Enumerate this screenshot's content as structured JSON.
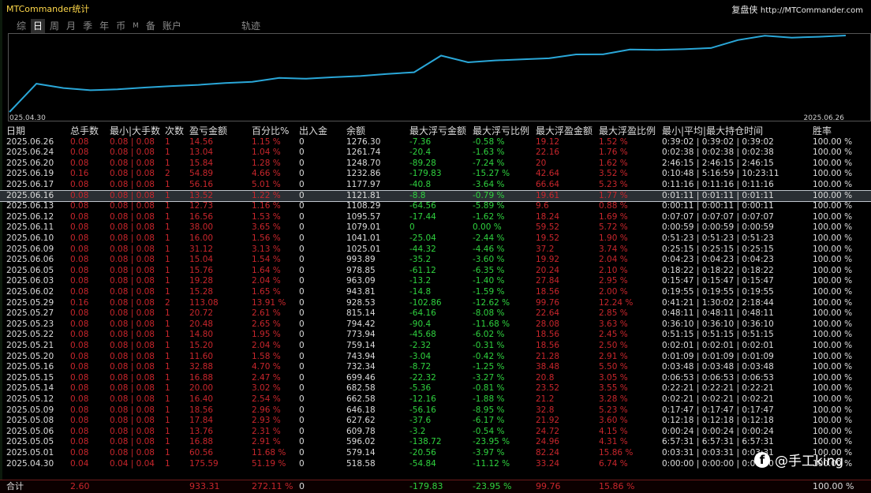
{
  "app": {
    "title": "MTCommander统计",
    "brand_name": "复盘侠",
    "brand_url": "http://MTCommander.com"
  },
  "tabs": [
    {
      "label": "综",
      "active": false
    },
    {
      "label": "日",
      "active": true
    },
    {
      "label": "周",
      "active": false
    },
    {
      "label": "月",
      "active": false
    },
    {
      "label": "季",
      "active": false
    },
    {
      "label": "年",
      "active": false
    },
    {
      "label": "币",
      "active": false
    },
    {
      "label": "M",
      "active": false
    },
    {
      "label": "备",
      "active": false
    },
    {
      "label": "账户",
      "active": false
    }
  ],
  "track_tab": "轨迹",
  "chart": {
    "start_label": "025.04.30",
    "end_label": "2025.06.26",
    "line_color": "#2aa7d8"
  },
  "headers": [
    "日期",
    "总手数",
    "最小|大手数",
    "次数",
    "盈亏金额",
    "百分比%",
    "出入金",
    "余额",
    "最大浮亏金额",
    "最大浮亏比例",
    "最大浮盈金额",
    "最大浮盈比例",
    "最小|平均|最大持仓时间",
    "胜率"
  ],
  "rows": [
    {
      "date": "2025.06.26",
      "lots": "0.08",
      "minmax": "0.08 | 0.08",
      "count": "1",
      "pnl": "14.56",
      "pct": "1.15 %",
      "io": "0",
      "balance": "1276.30",
      "max_loss": "-7.36",
      "max_loss_pct": "-0.58 %",
      "max_profit": "19.12",
      "max_profit_pct": "1.52 %",
      "hold": "0:39:02 | 0:39:02 | 0:39:02",
      "win": "100.00 %"
    },
    {
      "date": "2025.06.24",
      "lots": "0.08",
      "minmax": "0.08 | 0.08",
      "count": "1",
      "pnl": "13.04",
      "pct": "1.04 %",
      "io": "0",
      "balance": "1261.74",
      "max_loss": "-20.4",
      "max_loss_pct": "-1.63 %",
      "max_profit": "22.16",
      "max_profit_pct": "1.76 %",
      "hold": "0:02:38 | 0:02:38 | 0:02:38",
      "win": "100.00 %"
    },
    {
      "date": "2025.06.20",
      "lots": "0.08",
      "minmax": "0.08 | 0.08",
      "count": "1",
      "pnl": "15.84",
      "pct": "1.28 %",
      "io": "0",
      "balance": "1248.70",
      "max_loss": "-89.28",
      "max_loss_pct": "-7.24 %",
      "max_profit": "20",
      "max_profit_pct": "1.62 %",
      "hold": "2:46:15 | 2:46:15 | 2:46:15",
      "win": "100.00 %"
    },
    {
      "date": "2025.06.19",
      "lots": "0.16",
      "minmax": "0.08 | 0.08",
      "count": "2",
      "pnl": "54.89",
      "pct": "4.66 %",
      "io": "0",
      "balance": "1232.86",
      "max_loss": "-179.83",
      "max_loss_pct": "-15.27 %",
      "max_profit": "42.64",
      "max_profit_pct": "3.52 %",
      "hold": "0:10:48 | 5:16:59 | 10:23:11",
      "win": "100.00 %"
    },
    {
      "date": "2025.06.17",
      "lots": "0.08",
      "minmax": "0.08 | 0.08",
      "count": "1",
      "pnl": "56.16",
      "pct": "5.01 %",
      "io": "0",
      "balance": "1177.97",
      "max_loss": "-40.8",
      "max_loss_pct": "-3.64 %",
      "max_profit": "66.64",
      "max_profit_pct": "5.23 %",
      "hold": "0:11:16 | 0:11:16 | 0:11:16",
      "win": "100.00 %"
    },
    {
      "date": "2025.06.16",
      "lots": "0.08",
      "minmax": "0.08 | 0.08",
      "count": "1",
      "pnl": "13.52",
      "pct": "1.22 %",
      "io": "0",
      "balance": "1121.81",
      "max_loss": "-8.8",
      "max_loss_pct": "-0.79 %",
      "max_profit": "19.61",
      "max_profit_pct": "1.77 %",
      "hold": "0:01:11 | 0:01:11 | 0:01:11",
      "win": "100.00 %",
      "selected": true
    },
    {
      "date": "2025.06.13",
      "lots": "0.08",
      "minmax": "0.08 | 0.08",
      "count": "1",
      "pnl": "12.73",
      "pct": "1.16 %",
      "io": "0",
      "balance": "1108.29",
      "max_loss": "-64.56",
      "max_loss_pct": "-5.89 %",
      "max_profit": "9.6",
      "max_profit_pct": "0.88 %",
      "hold": "0:00:11 | 0:00:11 | 0:00:11",
      "win": "100.00 %"
    },
    {
      "date": "2025.06.12",
      "lots": "0.08",
      "minmax": "0.08 | 0.08",
      "count": "1",
      "pnl": "16.56",
      "pct": "1.53 %",
      "io": "0",
      "balance": "1095.57",
      "max_loss": "-17.44",
      "max_loss_pct": "-1.62 %",
      "max_profit": "18.24",
      "max_profit_pct": "1.69 %",
      "hold": "0:07:07 | 0:07:07 | 0:07:07",
      "win": "100.00 %"
    },
    {
      "date": "2025.06.11",
      "lots": "0.08",
      "minmax": "0.08 | 0.08",
      "count": "1",
      "pnl": "38.00",
      "pct": "3.65 %",
      "io": "0",
      "balance": "1079.01",
      "max_loss": "0",
      "max_loss_pct": "0.00 %",
      "max_profit": "59.52",
      "max_profit_pct": "5.72 %",
      "hold": "0:00:59 | 0:00:59 | 0:00:59",
      "win": "100.00 %"
    },
    {
      "date": "2025.06.10",
      "lots": "0.08",
      "minmax": "0.08 | 0.08",
      "count": "1",
      "pnl": "16.00",
      "pct": "1.56 %",
      "io": "0",
      "balance": "1041.01",
      "max_loss": "-25.04",
      "max_loss_pct": "-2.44 %",
      "max_profit": "19.52",
      "max_profit_pct": "1.90 %",
      "hold": "0:51:23 | 0:51:23 | 0:51:23",
      "win": "100.00 %"
    },
    {
      "date": "2025.06.09",
      "lots": "0.08",
      "minmax": "0.08 | 0.08",
      "count": "1",
      "pnl": "31.12",
      "pct": "3.13 %",
      "io": "0",
      "balance": "1025.01",
      "max_loss": "-44.32",
      "max_loss_pct": "-4.46 %",
      "max_profit": "37.2",
      "max_profit_pct": "3.74 %",
      "hold": "0:25:15 | 0:25:15 | 0:25:15",
      "win": "100.00 %"
    },
    {
      "date": "2025.06.06",
      "lots": "0.08",
      "minmax": "0.08 | 0.08",
      "count": "1",
      "pnl": "15.04",
      "pct": "1.54 %",
      "io": "0",
      "balance": "993.89",
      "max_loss": "-35.2",
      "max_loss_pct": "-3.60 %",
      "max_profit": "19.92",
      "max_profit_pct": "2.04 %",
      "hold": "0:04:23 | 0:04:23 | 0:04:23",
      "win": "100.00 %"
    },
    {
      "date": "2025.06.05",
      "lots": "0.08",
      "minmax": "0.08 | 0.08",
      "count": "1",
      "pnl": "15.76",
      "pct": "1.64 %",
      "io": "0",
      "balance": "978.85",
      "max_loss": "-61.12",
      "max_loss_pct": "-6.35 %",
      "max_profit": "20.24",
      "max_profit_pct": "2.10 %",
      "hold": "0:18:22 | 0:18:22 | 0:18:22",
      "win": "100.00 %"
    },
    {
      "date": "2025.06.03",
      "lots": "0.08",
      "minmax": "0.08 | 0.08",
      "count": "1",
      "pnl": "19.28",
      "pct": "2.04 %",
      "io": "0",
      "balance": "963.09",
      "max_loss": "-13.2",
      "max_loss_pct": "-1.40 %",
      "max_profit": "27.84",
      "max_profit_pct": "2.95 %",
      "hold": "0:15:47 | 0:15:47 | 0:15:47",
      "win": "100.00 %"
    },
    {
      "date": "2025.06.02",
      "lots": "0.08",
      "minmax": "0.08 | 0.08",
      "count": "1",
      "pnl": "15.28",
      "pct": "1.65 %",
      "io": "0",
      "balance": "943.81",
      "max_loss": "-14.8",
      "max_loss_pct": "-1.59 %",
      "max_profit": "18.56",
      "max_profit_pct": "2.00 %",
      "hold": "0:19:55 | 0:19:55 | 0:19:55",
      "win": "100.00 %"
    },
    {
      "date": "2025.05.29",
      "lots": "0.16",
      "minmax": "0.08 | 0.08",
      "count": "2",
      "pnl": "113.08",
      "pct": "13.91 %",
      "io": "0",
      "balance": "928.53",
      "max_loss": "-102.86",
      "max_loss_pct": "-12.62 %",
      "max_profit": "99.76",
      "max_profit_pct": "12.24 %",
      "hold": "0:41:21 | 1:30:02 | 2:18:44",
      "win": "100.00 %"
    },
    {
      "date": "2025.05.27",
      "lots": "0.08",
      "minmax": "0.08 | 0.08",
      "count": "1",
      "pnl": "20.72",
      "pct": "2.61 %",
      "io": "0",
      "balance": "815.14",
      "max_loss": "-64.16",
      "max_loss_pct": "-8.08 %",
      "max_profit": "22.64",
      "max_profit_pct": "2.85 %",
      "hold": "0:48:11 | 0:48:11 | 0:48:11",
      "win": "100.00 %"
    },
    {
      "date": "2025.05.23",
      "lots": "0.08",
      "minmax": "0.08 | 0.08",
      "count": "1",
      "pnl": "20.48",
      "pct": "2.65 %",
      "io": "0",
      "balance": "794.42",
      "max_loss": "-90.4",
      "max_loss_pct": "-11.68 %",
      "max_profit": "28.08",
      "max_profit_pct": "3.63 %",
      "hold": "0:36:10 | 0:36:10 | 0:36:10",
      "win": "100.00 %"
    },
    {
      "date": "2025.05.22",
      "lots": "0.08",
      "minmax": "0.08 | 0.08",
      "count": "1",
      "pnl": "14.80",
      "pct": "1.95 %",
      "io": "0",
      "balance": "773.94",
      "max_loss": "-45.68",
      "max_loss_pct": "-6.02 %",
      "max_profit": "18.56",
      "max_profit_pct": "2.45 %",
      "hold": "0:51:15 | 0:51:15 | 0:51:15",
      "win": "100.00 %"
    },
    {
      "date": "2025.05.21",
      "lots": "0.08",
      "minmax": "0.08 | 0.08",
      "count": "1",
      "pnl": "15.20",
      "pct": "2.04 %",
      "io": "0",
      "balance": "759.14",
      "max_loss": "-2.32",
      "max_loss_pct": "-0.31 %",
      "max_profit": "18.56",
      "max_profit_pct": "2.50 %",
      "hold": "0:02:01 | 0:02:01 | 0:02:01",
      "win": "100.00 %"
    },
    {
      "date": "2025.05.20",
      "lots": "0.08",
      "minmax": "0.08 | 0.08",
      "count": "1",
      "pnl": "11.60",
      "pct": "1.58 %",
      "io": "0",
      "balance": "743.94",
      "max_loss": "-3.04",
      "max_loss_pct": "-0.42 %",
      "max_profit": "21.28",
      "max_profit_pct": "2.91 %",
      "hold": "0:01:09 | 0:01:09 | 0:01:09",
      "win": "100.00 %"
    },
    {
      "date": "2025.05.16",
      "lots": "0.08",
      "minmax": "0.08 | 0.08",
      "count": "1",
      "pnl": "32.88",
      "pct": "4.70 %",
      "io": "0",
      "balance": "732.34",
      "max_loss": "-8.72",
      "max_loss_pct": "-1.25 %",
      "max_profit": "38.48",
      "max_profit_pct": "5.50 %",
      "hold": "0:03:48 | 0:03:48 | 0:03:48",
      "win": "100.00 %"
    },
    {
      "date": "2025.05.15",
      "lots": "0.08",
      "minmax": "0.08 | 0.08",
      "count": "1",
      "pnl": "16.88",
      "pct": "2.47 %",
      "io": "0",
      "balance": "699.46",
      "max_loss": "-22.32",
      "max_loss_pct": "-3.27 %",
      "max_profit": "20.8",
      "max_profit_pct": "3.05 %",
      "hold": "0:06:53 | 0:06:53 | 0:06:53",
      "win": "100.00 %"
    },
    {
      "date": "2025.05.14",
      "lots": "0.08",
      "minmax": "0.08 | 0.08",
      "count": "1",
      "pnl": "20.00",
      "pct": "3.02 %",
      "io": "0",
      "balance": "682.58",
      "max_loss": "-5.36",
      "max_loss_pct": "-0.81 %",
      "max_profit": "23.52",
      "max_profit_pct": "3.55 %",
      "hold": "0:22:21 | 0:22:21 | 0:22:21",
      "win": "100.00 %"
    },
    {
      "date": "2025.05.12",
      "lots": "0.08",
      "minmax": "0.08 | 0.08",
      "count": "1",
      "pnl": "16.40",
      "pct": "2.54 %",
      "io": "0",
      "balance": "662.58",
      "max_loss": "-12.16",
      "max_loss_pct": "-1.88 %",
      "max_profit": "21.2",
      "max_profit_pct": "3.28 %",
      "hold": "0:02:21 | 0:02:21 | 0:02:21",
      "win": "100.00 %"
    },
    {
      "date": "2025.05.09",
      "lots": "0.08",
      "minmax": "0.08 | 0.08",
      "count": "1",
      "pnl": "18.56",
      "pct": "2.96 %",
      "io": "0",
      "balance": "646.18",
      "max_loss": "-56.16",
      "max_loss_pct": "-8.95 %",
      "max_profit": "32.8",
      "max_profit_pct": "5.23 %",
      "hold": "0:17:47 | 0:17:47 | 0:17:47",
      "win": "100.00 %"
    },
    {
      "date": "2025.05.08",
      "lots": "0.08",
      "minmax": "0.08 | 0.08",
      "count": "1",
      "pnl": "17.84",
      "pct": "2.93 %",
      "io": "0",
      "balance": "627.62",
      "max_loss": "-37.6",
      "max_loss_pct": "-6.17 %",
      "max_profit": "21.92",
      "max_profit_pct": "3.60 %",
      "hold": "0:12:18 | 0:12:18 | 0:12:18",
      "win": "100.00 %"
    },
    {
      "date": "2025.05.06",
      "lots": "0.08",
      "minmax": "0.08 | 0.08",
      "count": "1",
      "pnl": "13.76",
      "pct": "2.31 %",
      "io": "0",
      "balance": "609.78",
      "max_loss": "-3.2",
      "max_loss_pct": "-0.54 %",
      "max_profit": "24.72",
      "max_profit_pct": "4.15 %",
      "hold": "0:00:24 | 0:00:24 | 0:00:24",
      "win": "100.00 %"
    },
    {
      "date": "2025.05.05",
      "lots": "0.08",
      "minmax": "0.08 | 0.08",
      "count": "1",
      "pnl": "16.88",
      "pct": "2.91 %",
      "io": "0",
      "balance": "596.02",
      "max_loss": "-138.72",
      "max_loss_pct": "-23.95 %",
      "max_profit": "24.96",
      "max_profit_pct": "4.31 %",
      "hold": "6:57:31 | 6:57:31 | 6:57:31",
      "win": "100.00 %"
    },
    {
      "date": "2025.05.01",
      "lots": "0.08",
      "minmax": "0.08 | 0.08",
      "count": "1",
      "pnl": "60.56",
      "pct": "11.68 %",
      "io": "0",
      "balance": "579.14",
      "max_loss": "-20.56",
      "max_loss_pct": "-3.97 %",
      "max_profit": "82.24",
      "max_profit_pct": "15.86 %",
      "hold": "0:03:31 | 0:03:31 | 0:03:31",
      "win": "100.00 %"
    },
    {
      "date": "2025.04.30",
      "lots": "0.04",
      "minmax": "0.04 | 0.04",
      "count": "1",
      "pnl": "175.59",
      "pct": "51.19 %",
      "io": "0",
      "balance": "518.58",
      "max_loss": "-54.84",
      "max_loss_pct": "-11.12 %",
      "max_profit": "33.24",
      "max_profit_pct": "6.74 %",
      "hold": "0:00:00 | 0:00:00 | 0:00:00",
      "win": "100.00 %"
    }
  ],
  "total": {
    "label": "合计",
    "lots": "2.60",
    "pnl": "933.31",
    "pct": "272.11 %",
    "io": "0",
    "max_loss": "-179.83",
    "max_loss_pct": "-23.95 %",
    "max_profit": "99.76",
    "max_profit_pct": "15.86 %",
    "win": "100.00 %"
  },
  "watermark": "@手工king",
  "colors": {
    "profit": "#c8262c",
    "loss": "#2fd33f",
    "accent": "#ffd84a"
  }
}
